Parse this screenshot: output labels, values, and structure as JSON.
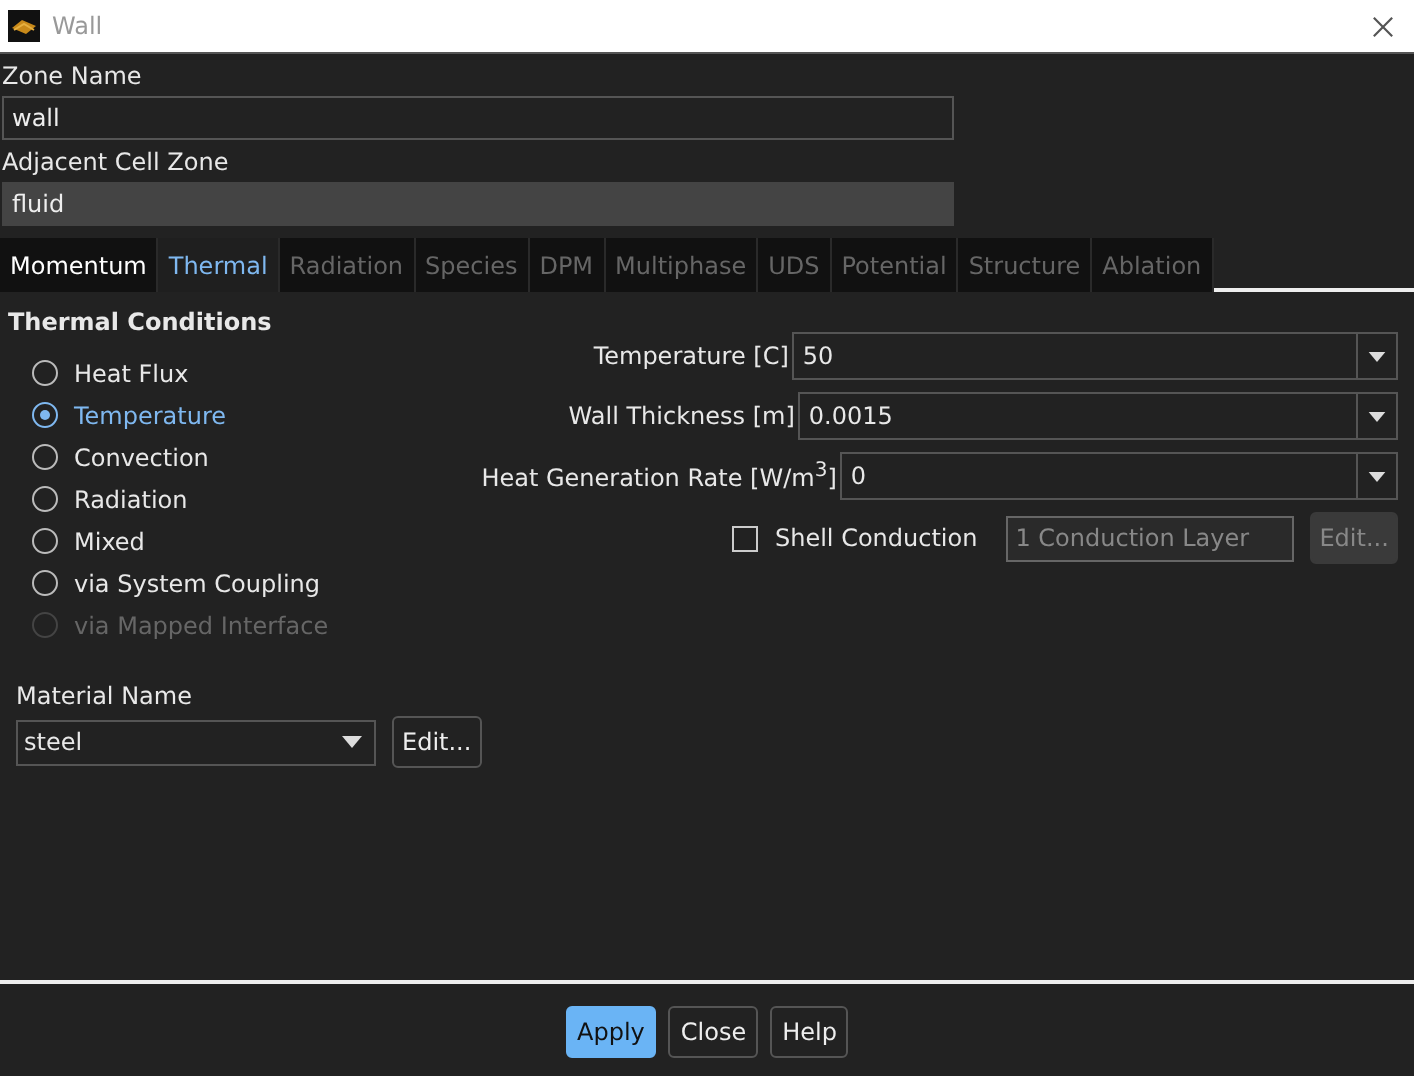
{
  "window": {
    "title": "Wall"
  },
  "zone_name": {
    "label": "Zone Name",
    "value": "wall"
  },
  "adjacent_cell_zone": {
    "label": "Adjacent Cell Zone",
    "value": "fluid"
  },
  "tabs": [
    {
      "label": "Momentum",
      "selected": false,
      "disabled": false
    },
    {
      "label": "Thermal",
      "selected": true,
      "disabled": false
    },
    {
      "label": "Radiation",
      "selected": false,
      "disabled": true
    },
    {
      "label": "Species",
      "selected": false,
      "disabled": true
    },
    {
      "label": "DPM",
      "selected": false,
      "disabled": true
    },
    {
      "label": "Multiphase",
      "selected": false,
      "disabled": true
    },
    {
      "label": "UDS",
      "selected": false,
      "disabled": true
    },
    {
      "label": "Potential",
      "selected": false,
      "disabled": true
    },
    {
      "label": "Structure",
      "selected": false,
      "disabled": true
    },
    {
      "label": "Ablation",
      "selected": false,
      "disabled": true
    }
  ],
  "thermal_conditions": {
    "title": "Thermal Conditions",
    "options": [
      {
        "label": "Heat Flux",
        "selected": false,
        "disabled": false
      },
      {
        "label": "Temperature",
        "selected": true,
        "disabled": false
      },
      {
        "label": "Convection",
        "selected": false,
        "disabled": false
      },
      {
        "label": "Radiation",
        "selected": false,
        "disabled": false
      },
      {
        "label": "Mixed",
        "selected": false,
        "disabled": false
      },
      {
        "label": "via System Coupling",
        "selected": false,
        "disabled": false
      },
      {
        "label": "via Mapped Interface",
        "selected": false,
        "disabled": true
      }
    ]
  },
  "parameters": [
    {
      "label": "Temperature [C]",
      "value": "50"
    },
    {
      "label": "Wall Thickness [m]",
      "value": "0.0015"
    },
    {
      "label": "Heat Generation Rate [W/m$^{3}$]",
      "value": "0"
    }
  ],
  "shell_conduction": {
    "label": "Shell Conduction",
    "checked": false,
    "layers": "1 Conduction Layer",
    "edit": "Edit...",
    "disabled": true
  },
  "material": {
    "label": "Material Name",
    "value": "steel",
    "edit": "Edit..."
  },
  "buttons": [
    {
      "label": "Apply",
      "kind": "primary"
    },
    {
      "label": "Close",
      "kind": "normal"
    },
    {
      "label": "Help",
      "kind": "normal"
    }
  ]
}
